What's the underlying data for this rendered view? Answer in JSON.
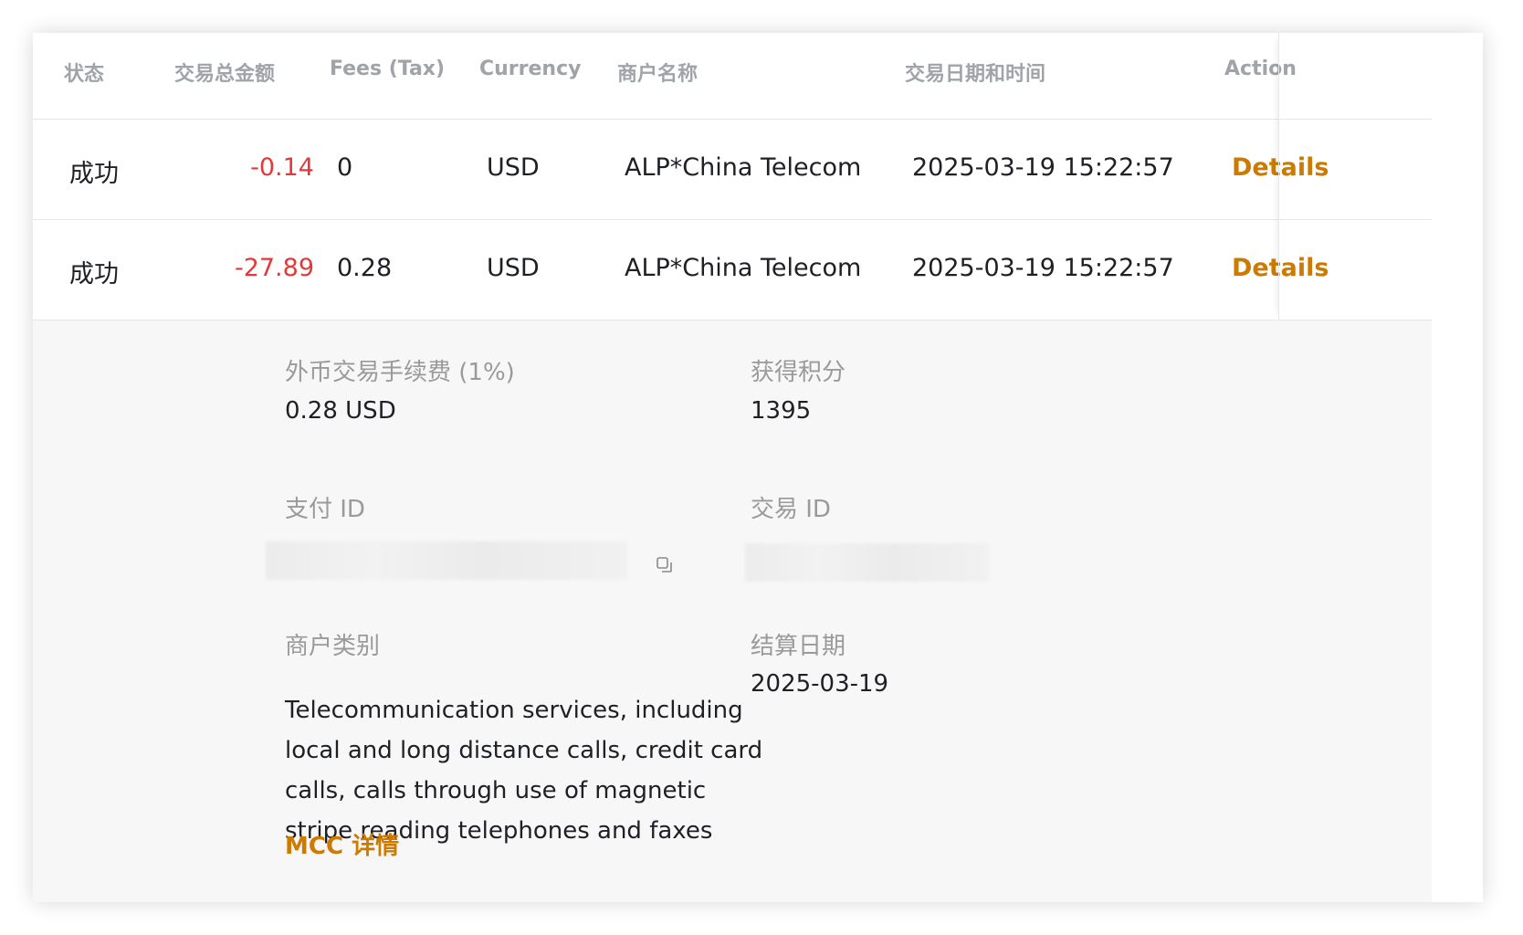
{
  "table": {
    "headers": {
      "status": "状态",
      "total": "交易总金额",
      "fees": "Fees (Tax)",
      "currency": "Currency",
      "merchant": "商户名称",
      "datetime": "交易日期和时间",
      "action": "Action"
    },
    "rows": [
      {
        "status": "成功",
        "total": "-0.14",
        "fees": "0",
        "currency": "USD",
        "merchant": "ALP*China Telecom",
        "datetime": "2025-03-19 15:22:57",
        "action": "Details"
      },
      {
        "status": "成功",
        "total": "-27.89",
        "fees": "0.28",
        "currency": "USD",
        "merchant": "ALP*China Telecom",
        "datetime": "2025-03-19 15:22:57",
        "action": "Details"
      }
    ]
  },
  "details": {
    "fx_fee_label": "外币交易手续费 (1%)",
    "fx_fee_value": "0.28 USD",
    "points_label": "获得积分",
    "points_value": "1395",
    "payment_id_label": "支付 ID",
    "transaction_id_label": "交易 ID",
    "merchant_category_label": "商户类别",
    "merchant_category_value": "Telecommunication services, including local and long distance calls, credit card calls, calls through use of magnetic stripe reading telephones and faxes",
    "mcc_link": "MCC 详情",
    "settlement_date_label": "结算日期",
    "settlement_date_value": "2025-03-19"
  },
  "icons": {
    "copy": "copy-icon"
  },
  "colors": {
    "negative_amount": "#e03a3a",
    "link": "#cc7a00",
    "header_text": "#a0a3a8",
    "details_background": "#f7f7f7"
  }
}
